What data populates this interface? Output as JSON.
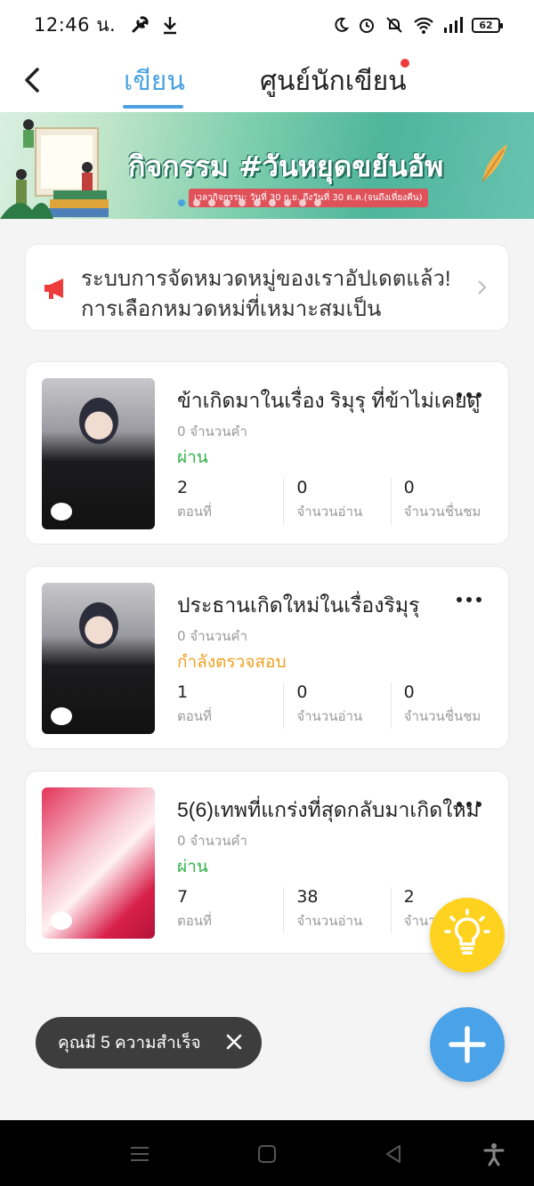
{
  "status_bar": {
    "time": "12:46 น.",
    "battery": "62"
  },
  "nav": {
    "tab_write": "เขียน",
    "tab_writer_center": "ศูนย์นักเขียน"
  },
  "banner": {
    "title": "กิจกรรม #วันหยุดขยันอัพ",
    "subtitle": "เวลากิจกรรม: วันที่ 30 ก.ย. ถึงวันที่ 30 ต.ค.(จนถึงเที่ยงคืน)"
  },
  "announcement": {
    "text": "ระบบการจัดหมวดหมู่ของเราอัปเดตแล้ว! การเลือกหมวดหมู่ที่เหมาะสมเป็น"
  },
  "stories": [
    {
      "title": "ข้าเกิดมาในเรื่อง ริมุรุ ที่ข้าไม่เคยดู",
      "word_count": "0 จำนวนคำ",
      "status": "ผ่าน",
      "chapters": "2",
      "chapters_label": "ตอนที่",
      "reads": "0",
      "reads_label": "จำนวนอ่าน",
      "likes": "0",
      "likes_label": "จำนวนชื่นชม"
    },
    {
      "title": "ประธานเกิดใหม่ในเรื่องริมุรุ",
      "word_count": "0 จำนวนคำ",
      "status": "กำลังตรวจสอบ",
      "chapters": "1",
      "chapters_label": "ตอนที่",
      "reads": "0",
      "reads_label": "จำนวนอ่าน",
      "likes": "0",
      "likes_label": "จำนวนชื่นชม"
    },
    {
      "title": "5(6)เทพที่แกร่งที่สุดกลับมาเกิดใหม่",
      "word_count": "0 จำนวนคำ",
      "status": "ผ่าน",
      "chapters": "7",
      "chapters_label": "ตอนที่",
      "reads": "38",
      "reads_label": "จำนวนอ่าน",
      "likes": "2",
      "likes_label": "จำนวนชื่นชม"
    }
  ],
  "toast": {
    "text": "คุณมี 5 ความสำเร็จ"
  },
  "colors": {
    "accent_blue": "#4aa3e0",
    "pass_green": "#33b249",
    "review_orange": "#f0a020",
    "idea_yellow": "#ffd21f"
  }
}
